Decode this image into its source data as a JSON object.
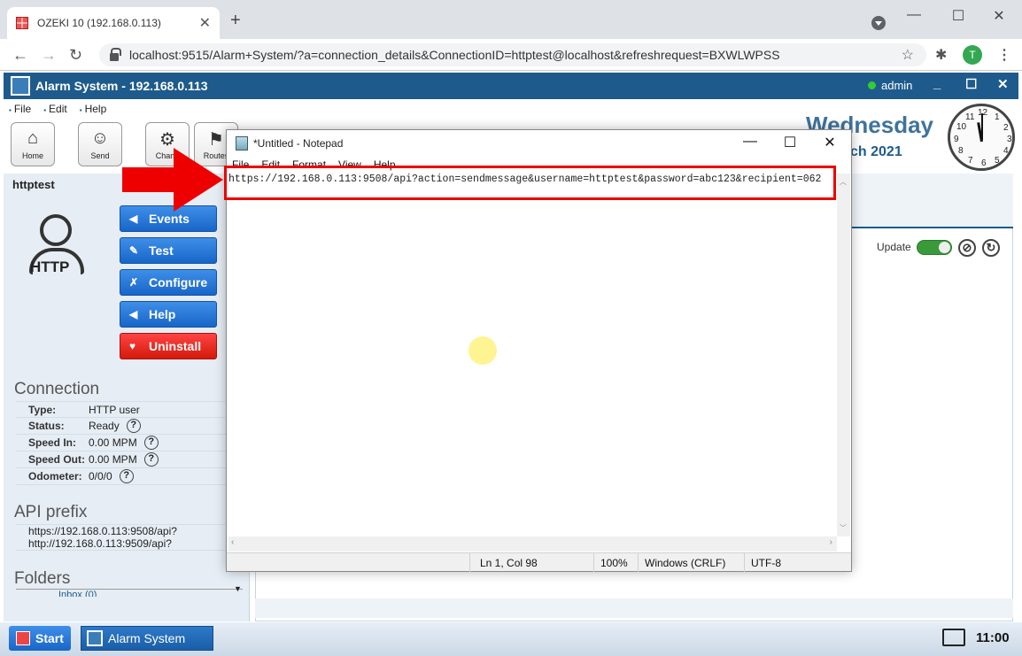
{
  "browser": {
    "tab_title": "OZEKI 10 (192.168.0.113)",
    "url": "localhost:9515/Alarm+System/?a=connection_details&ConnectionID=httptest@localhost&refreshrequest=BXWLWPSS",
    "profile_initial": "T"
  },
  "app": {
    "title": "Alarm System - 192.168.0.113",
    "user": "admin",
    "menu": [
      "File",
      "Edit",
      "Help"
    ],
    "toolbar": [
      {
        "label": "Home",
        "icon": "home-icon"
      },
      {
        "label": "Send",
        "icon": "user-send-icon"
      },
      {
        "label": "Chann",
        "icon": "channels-icon"
      },
      {
        "label": "Routes",
        "icon": "routes-icon"
      }
    ],
    "day": "Wednesday",
    "date_fragment": "ch 2021",
    "clock_numbers": [
      "12",
      "1",
      "2",
      "3",
      "4",
      "5",
      "6",
      "7",
      "8",
      "9",
      "10",
      "11"
    ]
  },
  "left": {
    "title": "httptest",
    "icon_text": "HTTP",
    "actions": [
      {
        "label": "Events",
        "icon": "events-icon"
      },
      {
        "label": "Test",
        "icon": "test-icon"
      },
      {
        "label": "Configure",
        "icon": "wrench-icon"
      },
      {
        "label": "Help",
        "icon": "help-icon"
      },
      {
        "label": "Uninstall",
        "icon": "broken-heart-icon"
      }
    ],
    "connection_title": "Connection",
    "connection": [
      {
        "key": "Type:",
        "value": "HTTP user",
        "help": false
      },
      {
        "key": "Status:",
        "value": "Ready",
        "help": true
      },
      {
        "key": "Speed In:",
        "value": "0.00 MPM",
        "help": true
      },
      {
        "key": "Speed Out:",
        "value": "0.00 MPM",
        "help": true
      },
      {
        "key": "Odometer:",
        "value": "0/0/0",
        "help": true
      }
    ],
    "api_title": "API prefix",
    "api_lines": [
      "https://192.168.0.113:9508/api?",
      "http://192.168.0.113:9509/api?"
    ],
    "folders_title": "Folders",
    "inbox": "Inbox (0)"
  },
  "right": {
    "update_label": "Update"
  },
  "notepad": {
    "title": "*Untitled - Notepad",
    "menu": [
      "File",
      "Edit",
      "Format",
      "View",
      "Help"
    ],
    "text": "https://192.168.0.113:9508/api?action=sendmessage&username=httptest&password=abc123&recipient=062",
    "status_pos": "Ln 1, Col 98",
    "status_zoom": "100%",
    "status_eol": "Windows (CRLF)",
    "status_enc": "UTF-8"
  },
  "taskbar": {
    "start": "Start",
    "app": "Alarm System",
    "time": "11:00"
  },
  "colors": {
    "accent": "#1e5b8c",
    "highlight": "#ee0000"
  }
}
